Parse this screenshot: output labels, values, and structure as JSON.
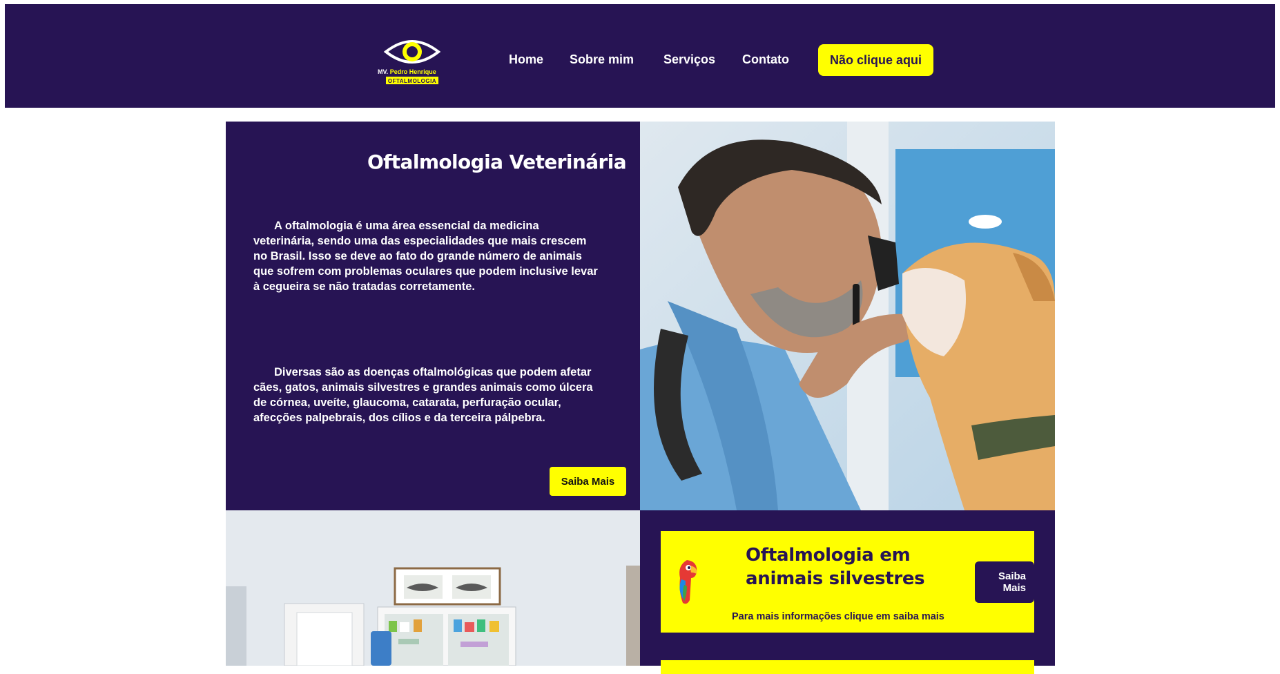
{
  "header": {
    "logo": {
      "icon": "eye-icon",
      "name_prefix": "MV.",
      "name": "Pedro Henrique",
      "specialty": "OFTALMOLOGIA"
    },
    "nav": [
      {
        "label": "Home"
      },
      {
        "label": "Sobre mim"
      },
      {
        "label": "Serviços"
      },
      {
        "label": "Contato"
      }
    ],
    "cta_label": "Não clique aqui"
  },
  "hero": {
    "title": "Oftalmologia Veterinária",
    "paragraphs": [
      "A oftalmologia é uma área essencial da medicina veterinária, sendo uma das especialidades que mais crescem no Brasil. Isso se deve ao fato do grande número de animais que sofrem com problemas oculares que podem inclusive levar à cegueira se não tratadas corretamente.",
      "Diversas são as doenças oftalmológicas que podem afetar cães, gatos, animais silvestres e grandes animais como úlcera de córnea, uveíte, glaucoma, catarata, perfuração ocular, afecções palpebrais, dos cílios e da terceira pálpebra."
    ],
    "button_label": "Saiba Mais"
  },
  "services": [
    {
      "icon": "parrot-icon",
      "title": "Oftalmologia em animais silvestres",
      "subtitle": "Para mais informações clique em saiba mais",
      "button_label": "Saiba Mais"
    }
  ],
  "colors": {
    "primary": "#271454",
    "accent": "#ffff00",
    "text_light": "#ffffff"
  }
}
